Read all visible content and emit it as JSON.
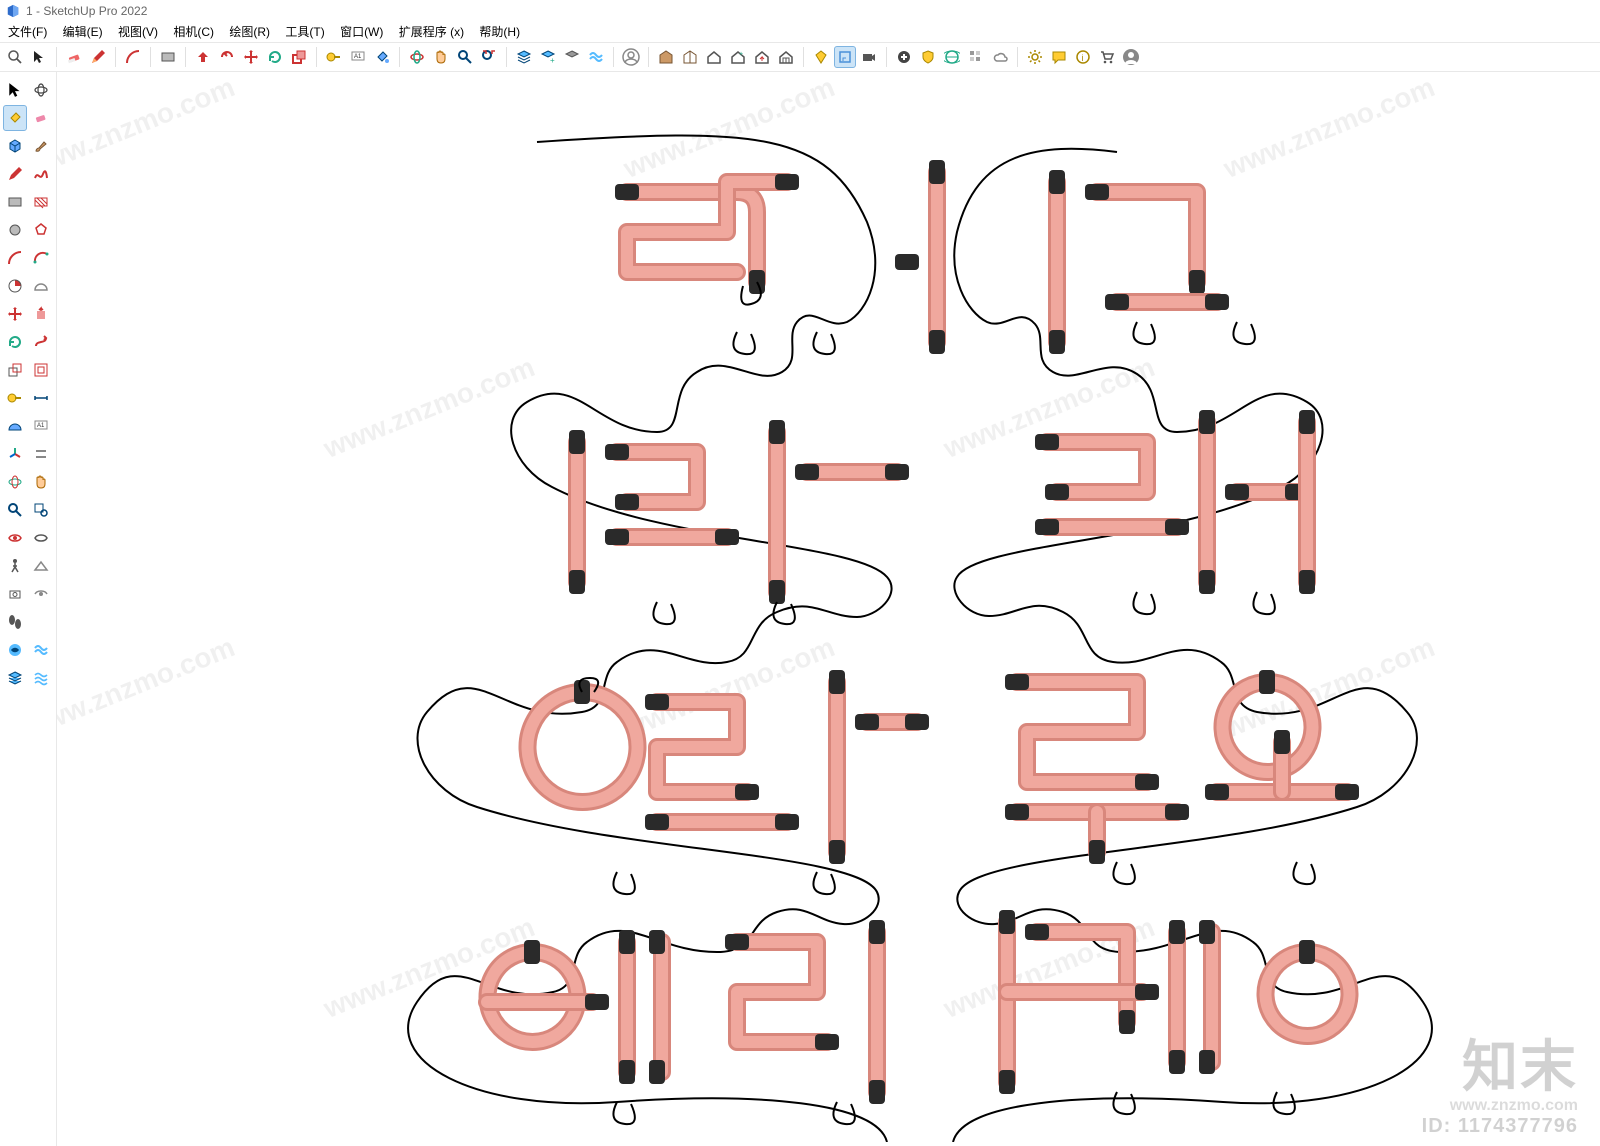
{
  "window": {
    "title": "1 - SketchUp Pro 2022",
    "app_name": "SketchUp Pro 2022"
  },
  "menus": [
    {
      "id": "file",
      "label": "文件(F)"
    },
    {
      "id": "edit",
      "label": "编辑(E)"
    },
    {
      "id": "view",
      "label": "视图(V)"
    },
    {
      "id": "camera",
      "label": "相机(C)"
    },
    {
      "id": "draw",
      "label": "绘图(R)"
    },
    {
      "id": "tools",
      "label": "工具(T)"
    },
    {
      "id": "window",
      "label": "窗口(W)"
    },
    {
      "id": "ext",
      "label": "扩展程序 (x)"
    },
    {
      "id": "help",
      "label": "帮助(H)"
    }
  ],
  "top_tools": [
    {
      "id": "search",
      "icon": "search-icon"
    },
    {
      "id": "select",
      "icon": "cursor-icon"
    },
    {
      "id": "sep"
    },
    {
      "id": "eraser",
      "icon": "eraser-icon"
    },
    {
      "id": "pencil",
      "icon": "pencil-icon"
    },
    {
      "id": "sep"
    },
    {
      "id": "arc",
      "icon": "arc-icon"
    },
    {
      "id": "sep"
    },
    {
      "id": "rect",
      "icon": "rectangle-icon"
    },
    {
      "id": "sep"
    },
    {
      "id": "pushpull",
      "icon": "pushpull-icon"
    },
    {
      "id": "offset",
      "icon": "offset-icon"
    },
    {
      "id": "move",
      "icon": "move-icon"
    },
    {
      "id": "rotate",
      "icon": "rotate-icon"
    },
    {
      "id": "scale",
      "icon": "scale-icon"
    },
    {
      "id": "sep"
    },
    {
      "id": "tape",
      "icon": "tape-icon"
    },
    {
      "id": "text",
      "icon": "text-icon"
    },
    {
      "id": "paint",
      "icon": "paint-bucket-icon"
    },
    {
      "id": "sep"
    },
    {
      "id": "orbit",
      "icon": "orbit-icon"
    },
    {
      "id": "pan",
      "icon": "pan-hand-icon"
    },
    {
      "id": "zoom",
      "icon": "zoom-icon"
    },
    {
      "id": "zoom-ext",
      "icon": "zoom-extents-icon"
    },
    {
      "id": "sep"
    },
    {
      "id": "layers1",
      "icon": "layers-icon"
    },
    {
      "id": "layers2",
      "icon": "layers-add-icon"
    },
    {
      "id": "layers3",
      "icon": "layers-hide-icon"
    },
    {
      "id": "layers4",
      "icon": "layers-wave-icon"
    },
    {
      "id": "sep"
    },
    {
      "id": "user",
      "icon": "user-circle-icon"
    },
    {
      "id": "sep"
    },
    {
      "id": "wh",
      "icon": "warehouse-box-icon"
    },
    {
      "id": "wh2",
      "icon": "warehouse-open-icon"
    },
    {
      "id": "house1",
      "icon": "house-icon"
    },
    {
      "id": "house2",
      "icon": "house-plus-icon"
    },
    {
      "id": "house3",
      "icon": "house-up-icon"
    },
    {
      "id": "house4",
      "icon": "house-grid-icon"
    },
    {
      "id": "sep"
    },
    {
      "id": "ext1",
      "icon": "diamond-icon"
    },
    {
      "id": "ext2",
      "icon": "select-box-icon",
      "active": true
    },
    {
      "id": "ext3",
      "icon": "camera-icon"
    },
    {
      "id": "sep"
    },
    {
      "id": "add",
      "icon": "plus-circle-icon"
    },
    {
      "id": "shield",
      "icon": "shield-icon"
    },
    {
      "id": "globe",
      "icon": "globe-icon"
    },
    {
      "id": "pattern",
      "icon": "grid-pattern-icon"
    },
    {
      "id": "cloud",
      "icon": "cloud-icon"
    },
    {
      "id": "sep"
    },
    {
      "id": "gear",
      "icon": "gear-icon"
    },
    {
      "id": "chat",
      "icon": "chat-icon"
    },
    {
      "id": "info",
      "icon": "info-circle-icon"
    },
    {
      "id": "cart",
      "icon": "cart-icon"
    },
    {
      "id": "profile",
      "icon": "person-circle-icon"
    }
  ],
  "side_tools": [
    [
      "cursor-black-icon",
      "orbit-small-icon"
    ],
    [
      "paint-small-icon",
      "eraser-small-icon"
    ],
    [
      "cube-icon",
      "brush-icon"
    ],
    [
      "pencil-red-icon",
      "freehand-icon"
    ],
    [
      "rect-small-icon",
      "rect-hatch-icon"
    ],
    [
      "circle-icon",
      "polygon-icon"
    ],
    [
      "arc-small-icon",
      "arc2-icon"
    ],
    [
      "pie-icon",
      "protractor-icon"
    ],
    [
      "move-red-icon",
      "pushpull-small-icon"
    ],
    [
      "rotate-green-icon",
      "followme-icon"
    ],
    [
      "scale-small-icon",
      "offset-small-icon"
    ],
    [
      "tape-small-icon",
      "dimension-icon"
    ],
    [
      "protractor2-icon",
      "text-small-icon"
    ],
    [
      "axes-icon",
      "section-icon"
    ],
    [
      "orbit2-icon",
      "pan-small-icon"
    ],
    [
      "zoom-small-icon",
      "zoom-window-icon"
    ],
    [
      "eye-icon",
      "eye2-icon"
    ],
    [
      "walk-icon",
      "look-icon"
    ],
    [
      "camera2-icon",
      "eye3-icon"
    ],
    [
      "shoes-icon",
      "blank"
    ],
    [
      "layer-blue-icon",
      "layer-wave-icon"
    ],
    [
      "layer-stack-icon",
      "layer-wave2-icon"
    ]
  ],
  "watermark_text": "www.znzmo.com",
  "watermark_brand": "知末",
  "watermark_sub": "www.znzmo.com",
  "watermark_id": "ID: 1174377796",
  "colors": {
    "neon": "#F0A89E",
    "neon_dk": "#D8877C",
    "cap": "#2A2A2A",
    "wire": "#000"
  }
}
